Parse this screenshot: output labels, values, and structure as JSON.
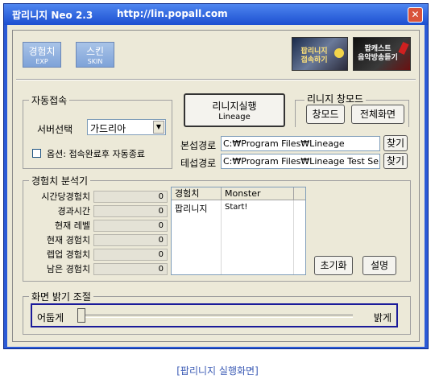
{
  "window": {
    "app_title": "팝리니지 Neo 2.3",
    "url": "http://lin.popall.com",
    "close_glyph": "✕"
  },
  "top_buttons": [
    {
      "label": "경험치",
      "sub": "EXP"
    },
    {
      "label": "스킨",
      "sub": "SKIN"
    }
  ],
  "banners": {
    "left_text": "팝리니지\n접속하기",
    "right_text": "팝캐스트\n음악방송듣기"
  },
  "auto_connect": {
    "title": "자동접속",
    "server_label": "서버선택",
    "server_value": "가드리아",
    "option_label": "옵션: 접속완료후 자동종료",
    "option_checked": false
  },
  "launch": {
    "line1": "리니지실행",
    "line2": "Lineage"
  },
  "window_mode": {
    "title": "리니지 창모드",
    "window_btn": "창모드",
    "fullscreen_btn": "전체화면"
  },
  "paths": [
    {
      "label": "본섭경로",
      "value": "C:₩Program Files₩Lineage",
      "find": "찾기"
    },
    {
      "label": "테섭경로",
      "value": "C:₩Program Files₩Lineage Test Server",
      "find": "찾기"
    }
  ],
  "exp_analyzer": {
    "title": "경험치 분석기",
    "stats": [
      {
        "label": "시간당경험치",
        "value": "0"
      },
      {
        "label": "경과시간",
        "value": "0"
      },
      {
        "label": "현재 레벨",
        "value": "0"
      },
      {
        "label": "현재 경험치",
        "value": "0"
      },
      {
        "label": "렙업 경험치",
        "value": "0"
      },
      {
        "label": "남은 경험치",
        "value": "0"
      }
    ],
    "list_headers": [
      "경험치",
      "Monster"
    ],
    "list_rows": [
      [
        "팝리니지",
        "Start!"
      ]
    ],
    "reset_btn": "초기화",
    "help_btn": "설명"
  },
  "brightness": {
    "title": "화면 밝기 조절",
    "dark_label": "어둡게",
    "bright_label": "밝게",
    "level": 0.0
  },
  "caption": "[팝리니지 실행화면]",
  "colors": {
    "title_bar": "#2b5ad6",
    "close": "#d9533b",
    "focus_border": "#1b1b9a"
  }
}
